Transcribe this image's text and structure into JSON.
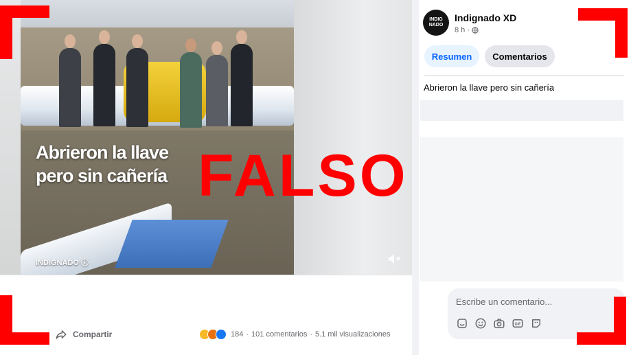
{
  "colors": {
    "falso_red": "#ff0000",
    "facebook_blue": "#0866ff",
    "text_secondary": "#65676b"
  },
  "video": {
    "caption_line1": "Abrieron la llave",
    "caption_line2": "pero sin cañería",
    "watermark": "INDIGNADO ⓘ"
  },
  "overlay": {
    "verdict": "FALSO"
  },
  "actions": {
    "share_label": "Compartir"
  },
  "stats": {
    "reaction_count": "184",
    "separator": "·",
    "comments": "101 comentarios",
    "views": "5.1 mil visualizaciones"
  },
  "post": {
    "avatar_text": "INDIG\nNADO",
    "page_name": "Indignado XD",
    "time": "8 h ·",
    "text": "Abrieron la llave pero sin cañería"
  },
  "tabs": {
    "summary": "Resumen",
    "comments": "Comentarios"
  },
  "comment": {
    "placeholder": "Escribe un comentario..."
  },
  "icons": {
    "share": "share-arrow-icon",
    "globe": "globe-icon",
    "volume": "volume-icon",
    "comment_tools": [
      "sticker-icon",
      "emoji-icon",
      "camera-icon",
      "gif-icon",
      "avatar-sticker-icon"
    ]
  }
}
